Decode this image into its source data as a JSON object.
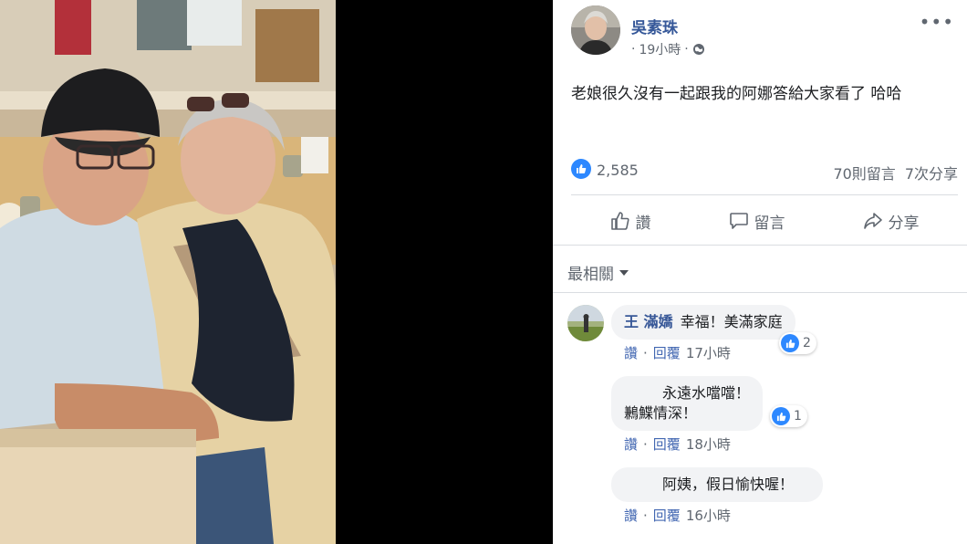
{
  "post": {
    "author": "吳素珠",
    "time": "19小時",
    "dot": "·",
    "text": "老娘很久沒有一起跟我的阿娜答給大家看了 哈哈",
    "more": "•••"
  },
  "stats": {
    "likes": "2,585",
    "comments": "70則留言",
    "shares": "7次分享"
  },
  "actions": {
    "like": "讚",
    "comment": "留言",
    "share": "分享"
  },
  "sort": {
    "label": "最相關"
  },
  "comments": [
    {
      "name": "王 滿嬌",
      "text": "幸福！美滿家庭",
      "like_link": "讚",
      "reply_link": "回覆",
      "time": "17小時",
      "reactions": "2"
    },
    {
      "name": "",
      "text_line1": "永遠水噹噹！",
      "text_line2": "鶼鰈情深！",
      "like_link": "讚",
      "reply_link": "回覆",
      "time": "18小時",
      "reactions": "1"
    },
    {
      "name": "",
      "text": "阿姨，假日愉快喔！",
      "like_link": "讚",
      "reply_link": "回覆",
      "time": "16小時"
    }
  ],
  "footer_separator": "·",
  "colors": {
    "link": "#365899",
    "like_blue": "#2d88ff",
    "muted": "#606770",
    "bubble": "#f2f3f5"
  }
}
